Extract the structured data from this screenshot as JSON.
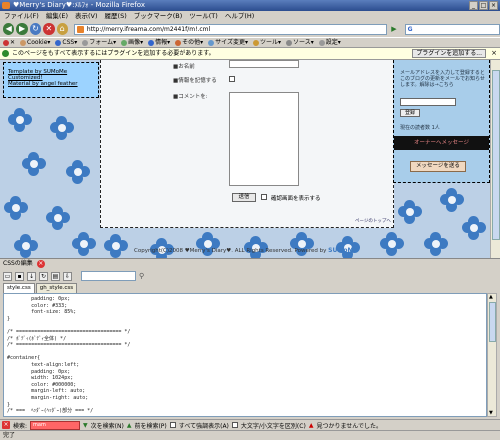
{
  "window": {
    "title": "♥Merry's Diary♥:ﾒﾙﾌｫ - Mozilla Firefox",
    "controls": [
      "_",
      "□",
      "×"
    ]
  },
  "menubar": [
    "ファイル(F)",
    "編集(E)",
    "表示(V)",
    "履歴(S)",
    "ブックマーク(B)",
    "ツール(T)",
    "ヘルプ(H)"
  ],
  "navbar": {
    "url": "http://merry.ifreama.com/m2441f/m!.cml",
    "go_label": "▶",
    "search_placeholder": ""
  },
  "webdev_toolbar": [
    "✕",
    "Cookie▾",
    "CSS▾",
    "フォーム▾",
    "画像▾",
    "情報▾",
    "その他▾",
    "サイズ変更▾",
    "ツール▾",
    "ソース▾",
    "設定▾"
  ],
  "notification": {
    "text": "このページをもすべて表示するにはプラグインを追加する必要があります。",
    "button": "プラグインを追加する...",
    "close": "×"
  },
  "page": {
    "left_box": [
      "Template by SUMoMe",
      "Customized!",
      "Material by angel feather"
    ],
    "form_labels": [
      "■お名前",
      "■情報を記憶する",
      "■コメントを:"
    ],
    "send_label": "送信",
    "confirm_label": "確認画面を表示する",
    "powered": "ページのトップへ",
    "right_box": {
      "text": "メールアドレスを入力して登録するとこのブログの更新をメールでお知らせします。解除は→こちら",
      "button": "登録",
      "subscribers": "現在の読者数 1人",
      "header": "オーナーへメッセージ",
      "message_button": "メッセージを送る"
    },
    "copyright": "Copyright(C)2008 ♥Merry's Diary♥. ALL Rights Reserved. Powered by",
    "copyright_logo": "SUMoMe"
  },
  "css_panel": {
    "title": "CSSの編集",
    "tabs": [
      "style.css",
      "gh_style.css"
    ],
    "code": "        padding: 0px;\n        color: #333;\n        font-size: 85%;\n}\n\n/* =================================== */\n/* ﾎﾞﾃﾞｨ(ﾎﾞﾃﾞｨ全体) */\n/* =================================== */\n\n#container{\n        text-align:left;\n        padding: 0px;\n        width: 1024px;\n        color: #000000;\n        margin-left: auto;\n        margin-right: auto;\n}\n/* ===  ﾍｯﾀﾞｰ(ﾍｯﾀﾞｰ)部分 === */"
  },
  "findbar": {
    "label": "検索:",
    "value": "mam",
    "next": "次を検索(N)",
    "prev": "前を検索(P)",
    "highlight": "すべて強調表示(A)",
    "match_case": "大文字/小文字を区別(C)",
    "not_found": "見つかりませんでした。"
  },
  "status": "完了"
}
